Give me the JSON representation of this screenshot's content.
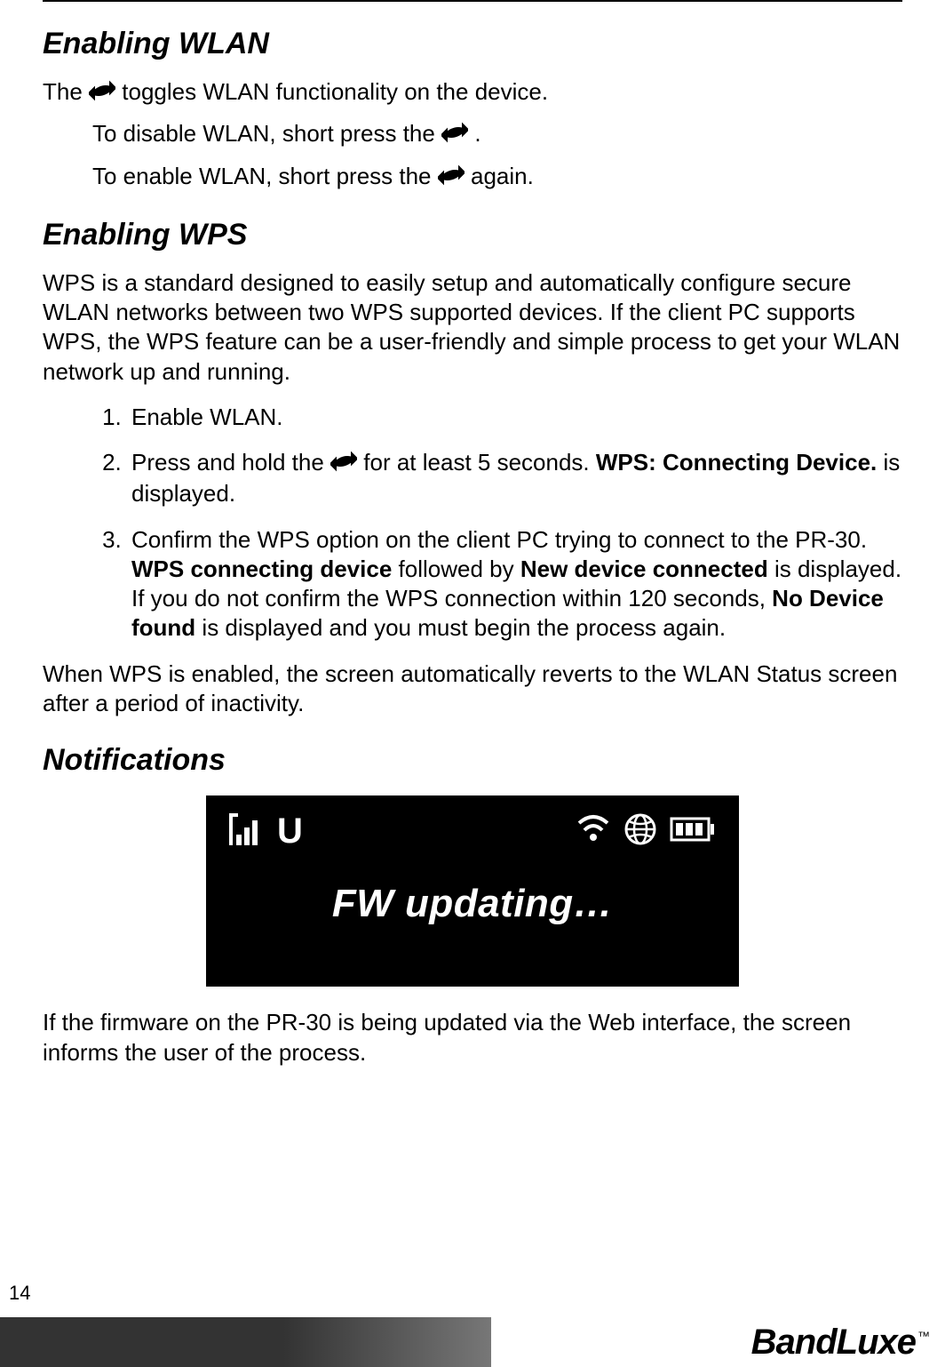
{
  "sections": {
    "wlan_heading": "Enabling WLAN",
    "wlan_p1_a": "The ",
    "wlan_p1_b": " toggles WLAN functionality on the device.",
    "wlan_disable_a": "To disable WLAN, short press the",
    "wlan_disable_b": " .",
    "wlan_enable_a": "To enable WLAN, short press the ",
    "wlan_enable_b": " again.",
    "wps_heading": "Enabling WPS",
    "wps_intro": "WPS is a standard designed to easily setup and automatically configure secure WLAN networks between two WPS supported devices. If the client PC supports WPS, the WPS feature can be a user-friendly and simple process to get your WLAN network up and running.",
    "steps": {
      "s1": "Enable WLAN.",
      "s2_a": "Press and hold the ",
      "s2_b": " for at least 5 seconds. ",
      "s2_bold": "WPS: Connecting Device.",
      "s2_c": " is displayed.",
      "s3_a": "Confirm the WPS option on the client PC trying to connect to the PR-30. ",
      "s3_b1": "WPS connecting device",
      "s3_mid": " followed by ",
      "s3_b2": "New device connected",
      "s3_c": " is displayed. If you do not confirm the WPS connection within 120 seconds, ",
      "s3_b3": "No Device found",
      "s3_d": " is displayed and you must begin the process again."
    },
    "wps_outro": "When WPS is enabled, the screen automatically reverts to the WLAN Status screen after a period of inactivity.",
    "notif_heading": "Notifications",
    "notif_body": "If the firmware on the PR-30 is being updated via the Web interface, the screen informs the user of the process."
  },
  "device_screen": {
    "network_label": "U",
    "main_text": "FW updating…"
  },
  "footer": {
    "page_number": "14",
    "brand": "BandLuxe",
    "tm": "™"
  }
}
